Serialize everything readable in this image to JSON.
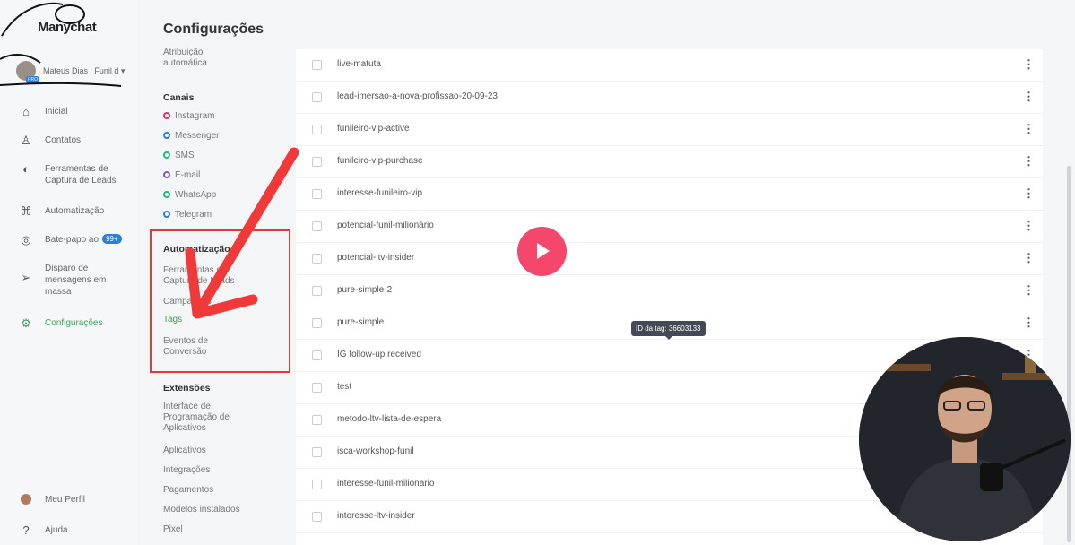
{
  "app": {
    "logo": "Manychat",
    "page_title": "Configurações"
  },
  "account": {
    "name": "Mateus Dias | Funil d ▾",
    "badge": "PRO"
  },
  "nav": [
    {
      "label": "Inicial",
      "icon": "home-icon"
    },
    {
      "label": "Contatos",
      "icon": "contacts-icon"
    },
    {
      "label": "Ferramentas de Captura de Leads",
      "icon": "magnet-icon"
    },
    {
      "label": "Automatização",
      "icon": "automation-icon"
    },
    {
      "label": "Bate-papo ao",
      "icon": "chat-icon",
      "badge": "99+"
    },
    {
      "label": "Disparo de mensagens em massa",
      "icon": "send-icon"
    },
    {
      "label": "Configurações",
      "icon": "settings-icon",
      "active": true
    }
  ],
  "nav_bottom": [
    {
      "label": "Meu Perfil",
      "icon": "profile-avatar"
    },
    {
      "label": "Ajuda",
      "icon": "help-icon"
    }
  ],
  "settings": {
    "top_item": "Atribuição automática",
    "canais_title": "Canais",
    "canais": [
      {
        "label": "Instagram",
        "color": "#e1306c"
      },
      {
        "label": "Messenger",
        "color": "#2a7de1"
      },
      {
        "label": "SMS",
        "color": "#2bb673"
      },
      {
        "label": "E-mail",
        "color": "#7e57c2"
      },
      {
        "label": "WhatsApp",
        "color": "#2bb673"
      },
      {
        "label": "Telegram",
        "color": "#2a7de1"
      }
    ],
    "automacao_title": "Automatização",
    "automacao": [
      "Ferramentas de Captura de Leads",
      "Campanhas",
      "Tags",
      "Eventos de Conversão"
    ],
    "extensoes_title": "Extensões",
    "extensoes": [
      "Interface de Programação de Aplicativos",
      "Aplicativos",
      "Integrações",
      "Pagamentos",
      "Modelos instalados",
      "Pixel"
    ]
  },
  "tags": [
    "live-matuta",
    "lead-imersao-a-nova-profissao-20-09-23",
    "funileiro-vip-active",
    "funileiro-vip-purchase",
    "interesse-funileiro-vip",
    "potencial-funil-milionário",
    "potencial-ltv-insider",
    "pure-simple-2",
    "pure-simple",
    "IG follow-up received",
    "test",
    "metodo-ltv-lista-de-espera",
    "isca-workshop-funil",
    "interesse-funil-milionario",
    "interesse-ltv-insider"
  ],
  "tooltip": "ID da tag: 36603133",
  "colors": {
    "accent_green": "#3aa35a",
    "highlight_red": "#e53935",
    "play_pink": "#f4476b"
  }
}
